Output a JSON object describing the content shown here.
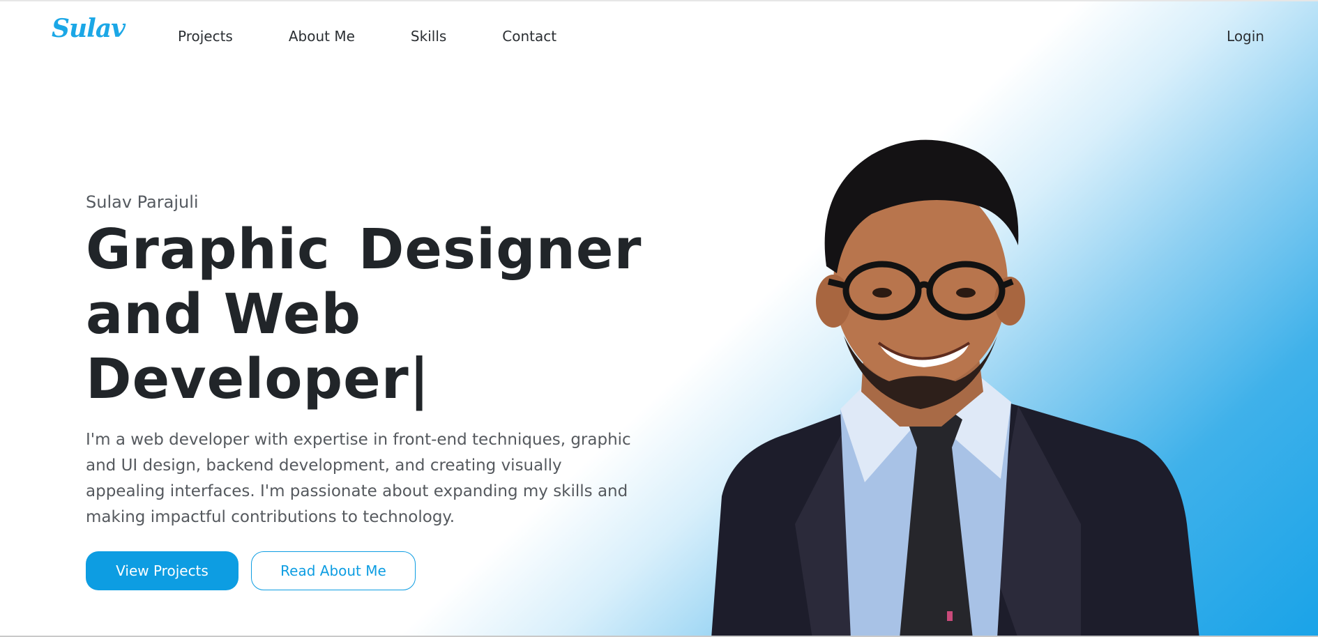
{
  "brand": {
    "logo_text": "Sulav",
    "accent_color": "#0d9de2"
  },
  "nav": {
    "links": [
      "Projects",
      "About Me",
      "Skills",
      "Contact"
    ],
    "login_label": "Login"
  },
  "hero": {
    "name": "Sulav Parajuli",
    "title_line1_a": "Graphic",
    "title_line1_b": "Designer",
    "title_line2": "and Web",
    "title_line3": "Developer",
    "cursor": "|",
    "description": "I'm a web developer with expertise in front-end techniques, graphic and UI design, backend development, and creating visually appealing interfaces. I'm passionate about expanding my skills and making impactful contributions to technology.",
    "primary_button": "View Projects",
    "secondary_button": "Read About Me"
  },
  "portrait": {
    "icon": "person-portrait-photo"
  }
}
